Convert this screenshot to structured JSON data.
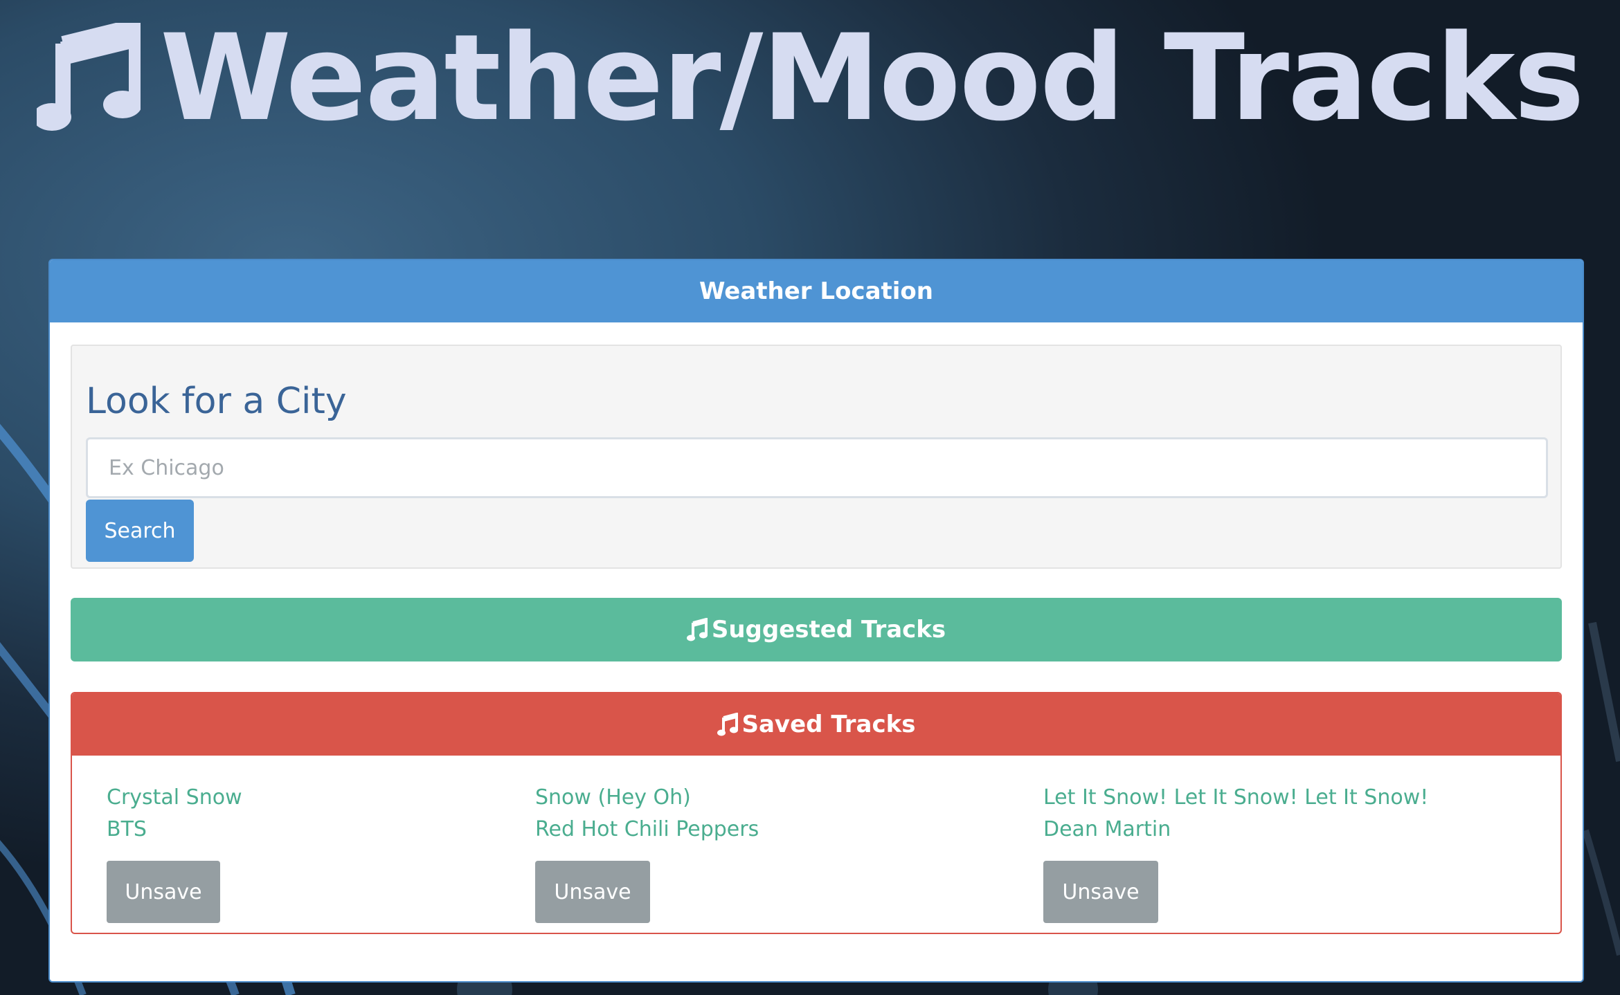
{
  "header": {
    "title": "Weather/Mood Tracks",
    "icon": "music-note-icon"
  },
  "weather_card": {
    "header": "Weather Location",
    "search": {
      "heading": "Look for a City",
      "placeholder": "Ex Chicago",
      "value": "",
      "button_label": "Search"
    }
  },
  "suggested": {
    "header": "Suggested Tracks",
    "icon": "music-note-icon"
  },
  "saved": {
    "header": "Saved Tracks",
    "icon": "music-note-icon",
    "tracks": [
      {
        "title": "Crystal Snow",
        "artist": "BTS",
        "button_label": "Unsave"
      },
      {
        "title": "Snow (Hey Oh)",
        "artist": "Red Hot Chili Peppers",
        "button_label": "Unsave"
      },
      {
        "title": "Let It Snow! Let It Snow! Let It Snow!",
        "artist": "Dean Martin",
        "button_label": "Unsave"
      }
    ]
  },
  "colors": {
    "primary": "#4f94d4",
    "success": "#5bbb9c",
    "danger": "#d9554a",
    "track_link": "#4aad8f",
    "unsave_button": "#959ea2",
    "title_text": "#d6dcf1",
    "heading_text": "#3a6497"
  }
}
